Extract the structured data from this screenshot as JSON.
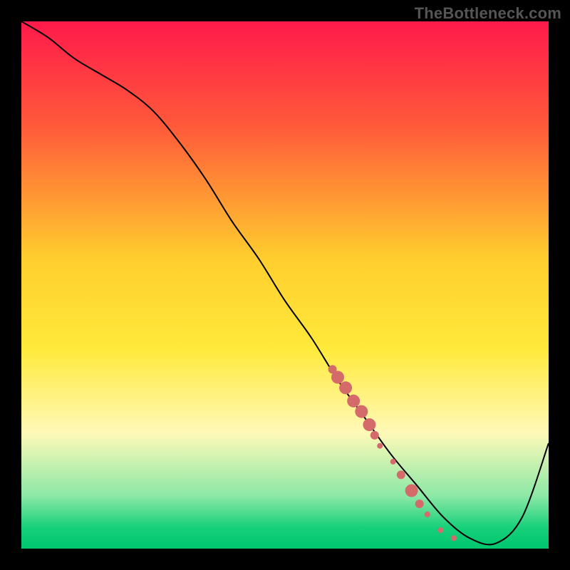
{
  "watermark": "TheBottleneck.com",
  "chart_data": {
    "type": "line",
    "title": "",
    "xlabel": "",
    "ylabel": "",
    "xlim": [
      0,
      100
    ],
    "ylim": [
      0,
      100
    ],
    "grid": false,
    "gradient_stops": [
      {
        "offset": 0.0,
        "color": "#ff1a4b"
      },
      {
        "offset": 0.2,
        "color": "#ff5a3a"
      },
      {
        "offset": 0.45,
        "color": "#ffce2e"
      },
      {
        "offset": 0.62,
        "color": "#ffe93a"
      },
      {
        "offset": 0.78,
        "color": "#fff9b8"
      },
      {
        "offset": 0.9,
        "color": "#8ce8a6"
      },
      {
        "offset": 0.96,
        "color": "#17d07a"
      },
      {
        "offset": 1.0,
        "color": "#00c56f"
      }
    ],
    "curve": {
      "x": [
        0,
        5,
        10,
        15,
        20,
        25,
        30,
        35,
        40,
        45,
        50,
        55,
        60,
        65,
        70,
        75,
        80,
        85,
        90,
        95,
        100
      ],
      "y": [
        100,
        97,
        93,
        90,
        87,
        83,
        77,
        70,
        62,
        55,
        47,
        40,
        32,
        25,
        18,
        12,
        6,
        2,
        1,
        6,
        20
      ]
    },
    "markers": [
      {
        "x": 59.0,
        "y": 34.0,
        "size": "medium"
      },
      {
        "x": 60.0,
        "y": 32.5,
        "size": "large"
      },
      {
        "x": 61.5,
        "y": 30.5,
        "size": "large"
      },
      {
        "x": 63.0,
        "y": 28.0,
        "size": "large"
      },
      {
        "x": 64.5,
        "y": 26.0,
        "size": "large"
      },
      {
        "x": 66.0,
        "y": 23.5,
        "size": "large"
      },
      {
        "x": 67.0,
        "y": 21.5,
        "size": "medium"
      },
      {
        "x": 68.0,
        "y": 19.5,
        "size": "small"
      },
      {
        "x": 70.5,
        "y": 16.5,
        "size": "small"
      },
      {
        "x": 72.0,
        "y": 14.0,
        "size": "medium"
      },
      {
        "x": 74.0,
        "y": 11.0,
        "size": "large"
      },
      {
        "x": 75.5,
        "y": 8.5,
        "size": "medium"
      },
      {
        "x": 77.0,
        "y": 6.5,
        "size": "small"
      },
      {
        "x": 79.5,
        "y": 3.5,
        "size": "small"
      },
      {
        "x": 82.0,
        "y": 2.0,
        "size": "small"
      }
    ],
    "marker_radii": {
      "small": 4,
      "medium": 6,
      "large": 9
    },
    "marker_color": "#d56a6a",
    "line_color": "#000000",
    "line_width": 2,
    "legend": null
  }
}
